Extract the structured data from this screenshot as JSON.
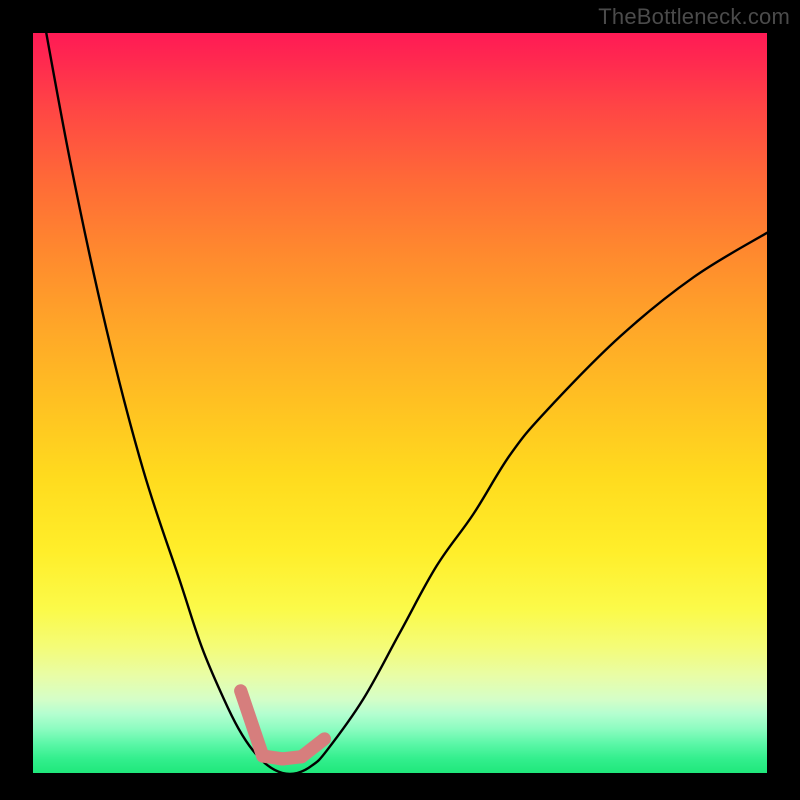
{
  "watermark": "TheBottleneck.com",
  "chart_data": {
    "type": "line",
    "title": "",
    "xlabel": "",
    "ylabel": "",
    "xlim": [
      0,
      100
    ],
    "ylim": [
      0,
      100
    ],
    "grid": false,
    "x": [
      0,
      5,
      10,
      15,
      20,
      23,
      26,
      28,
      30,
      32,
      34,
      36,
      38,
      40,
      45,
      50,
      55,
      60,
      65,
      70,
      80,
      90,
      100
    ],
    "values": [
      110,
      83,
      60,
      41,
      26,
      17,
      10,
      6,
      3,
      1,
      0,
      0,
      1,
      3,
      10,
      19,
      28,
      35,
      43,
      49,
      59,
      67,
      73
    ],
    "notch": {
      "segments": [
        {
          "x1": 28.3,
          "y1": 11.1,
          "x2": 31.3,
          "y2": 2.3
        },
        {
          "x1": 31.3,
          "y1": 2.3,
          "x2": 34.0,
          "y2": 1.9
        },
        {
          "x1": 34.0,
          "y1": 1.9,
          "x2": 36.6,
          "y2": 2.2
        },
        {
          "x1": 36.6,
          "y1": 2.2,
          "x2": 39.7,
          "y2": 4.6
        }
      ],
      "color": "#d67e7d",
      "width_frac": 0.018,
      "cap": "round"
    },
    "gradient_stops": [
      {
        "pos": 0.0,
        "color": "#ff1a55"
      },
      {
        "pos": 0.5,
        "color": "#ffc122"
      },
      {
        "pos": 0.8,
        "color": "#fbfa4a"
      },
      {
        "pos": 1.0,
        "color": "#1fe87b"
      }
    ]
  }
}
